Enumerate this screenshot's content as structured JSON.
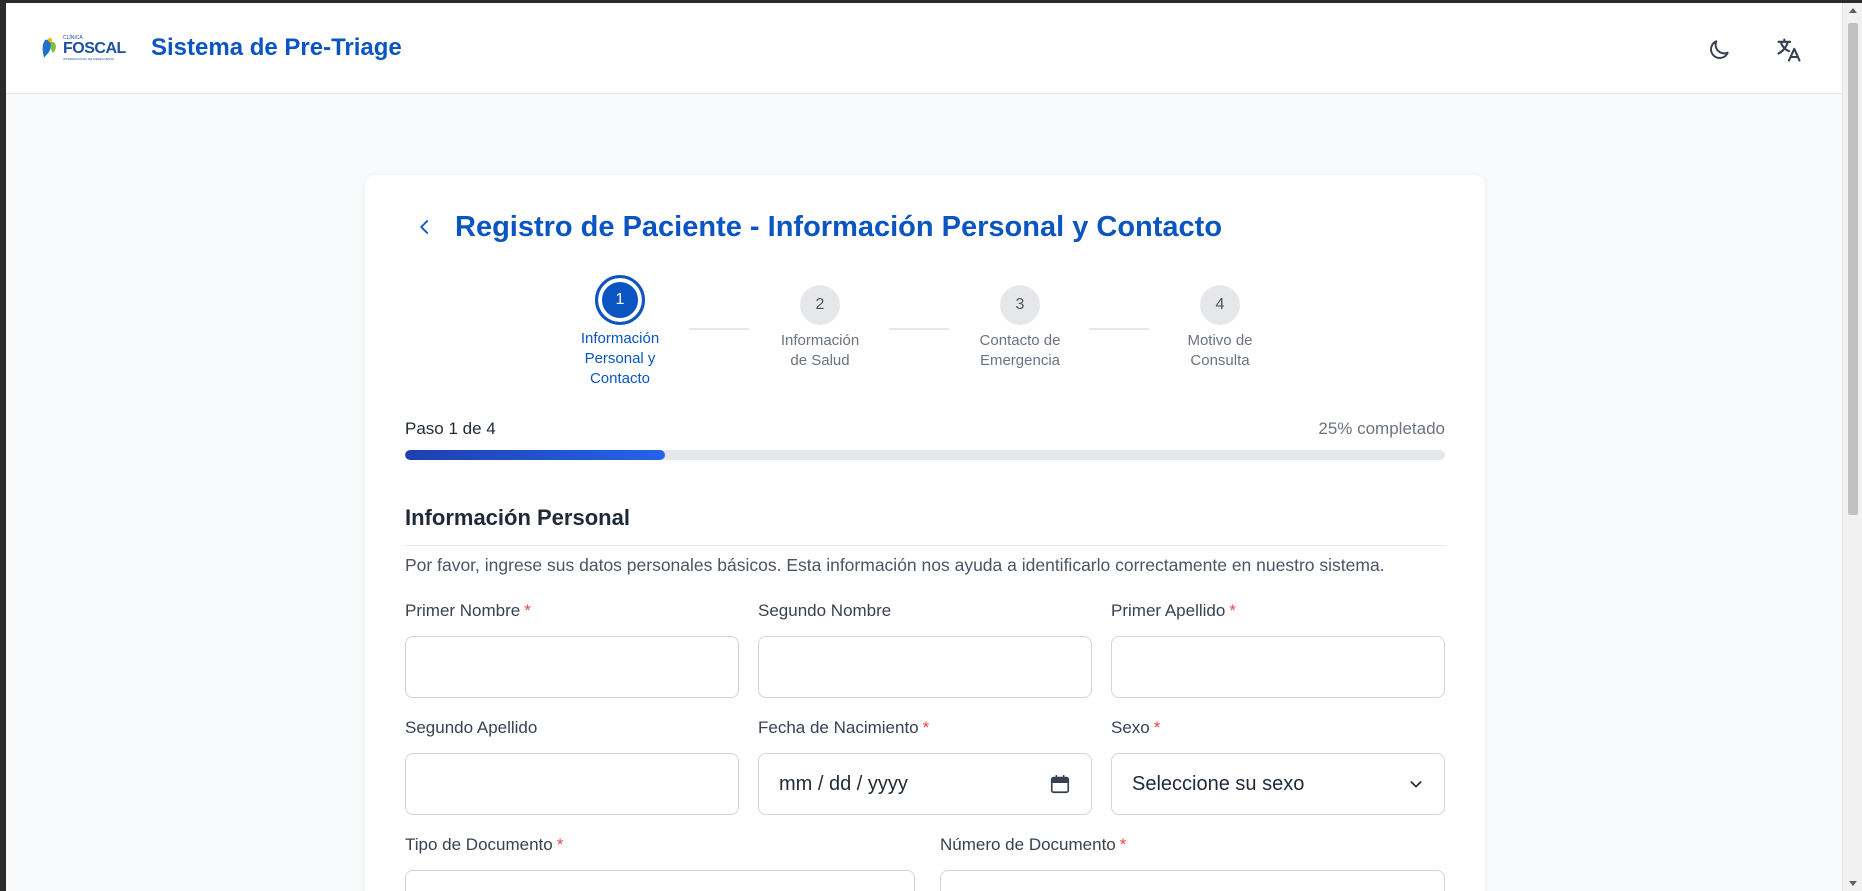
{
  "header": {
    "logo_top": "CLÍNICA",
    "logo_name": "FOSCAL",
    "logo_sub": "INTERNACIONAL DE PIEDECUESTA",
    "app_title": "Sistema de Pre-Triage",
    "theme_icon": "moon-icon",
    "language_icon": "translate-icon"
  },
  "form": {
    "back_icon": "chevron-left-icon",
    "title": "Registro de Paciente - Información Personal y Contacto",
    "steps": [
      {
        "number": "1",
        "label_lines": [
          "Información",
          "Personal y",
          "Contacto"
        ],
        "active": true
      },
      {
        "number": "2",
        "label_lines": [
          "Información",
          "de Salud"
        ],
        "active": false
      },
      {
        "number": "3",
        "label_lines": [
          "Contacto de",
          "Emergencia"
        ],
        "active": false
      },
      {
        "number": "4",
        "label_lines": [
          "Motivo de",
          "Consulta"
        ],
        "active": false
      }
    ],
    "progress": {
      "step_text": "Paso 1 de 4",
      "percent_text": "25% completado",
      "percent": 25
    },
    "section": {
      "title": "Información Personal",
      "description": "Por favor, ingrese sus datos personales básicos. Esta información nos ayuda a identificarlo correctamente en nuestro sistema."
    },
    "fields": {
      "primer_nombre": {
        "label": "Primer Nombre",
        "required": "*",
        "value": ""
      },
      "segundo_nombre": {
        "label": "Segundo Nombre",
        "value": ""
      },
      "primer_apellido": {
        "label": "Primer Apellido",
        "required": "*",
        "value": ""
      },
      "segundo_apellido": {
        "label": "Segundo Apellido",
        "value": ""
      },
      "fecha_nacimiento": {
        "label": "Fecha de Nacimiento",
        "required": "*",
        "placeholder": "mm / dd / yyyy",
        "icon": "calendar-icon"
      },
      "sexo": {
        "label": "Sexo",
        "required": "*",
        "placeholder": "Seleccione su sexo",
        "icon": "chevron-down-icon"
      },
      "tipo_documento": {
        "label": "Tipo de Documento",
        "required": "*"
      },
      "numero_documento": {
        "label": "Número de Documento",
        "required": "*"
      }
    }
  }
}
